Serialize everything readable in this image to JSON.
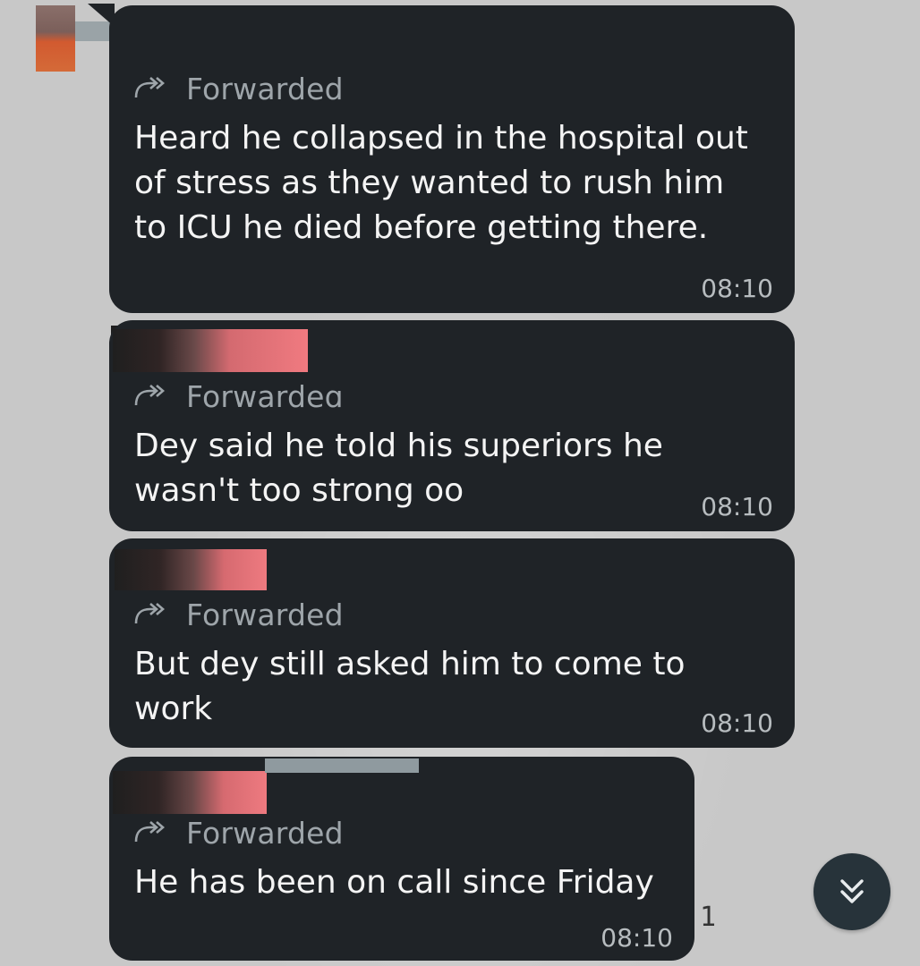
{
  "messages": [
    {
      "forwarded_label": "Forwarded",
      "text": "Heard he collapsed in the hospital out of stress as they wanted to rush him to ICU he died before getting there.",
      "time": "08:10"
    },
    {
      "forwarded_label": "Forwardeɑ",
      "text": "Dey said he told his superiors he wasn't too strong oo",
      "time": "08:10"
    },
    {
      "forwarded_label": "Forwarded",
      "text": "But dey still asked him to come to work",
      "time": "08:10"
    },
    {
      "forwarded_label": "Forwarded",
      "text": "He has been on call since Friday",
      "time": "08:10"
    }
  ],
  "unread_count": "1",
  "icons": {
    "forward": "forward-arrow-icon",
    "scroll_down": "double-chevron-down-icon"
  },
  "colors": {
    "bubble": "#1f2327",
    "forwarded_label": "#9ea5aa",
    "timestamp": "#b7bcbf",
    "wallpaper": "#c8c8c8",
    "scroll_button": "#27333a"
  }
}
